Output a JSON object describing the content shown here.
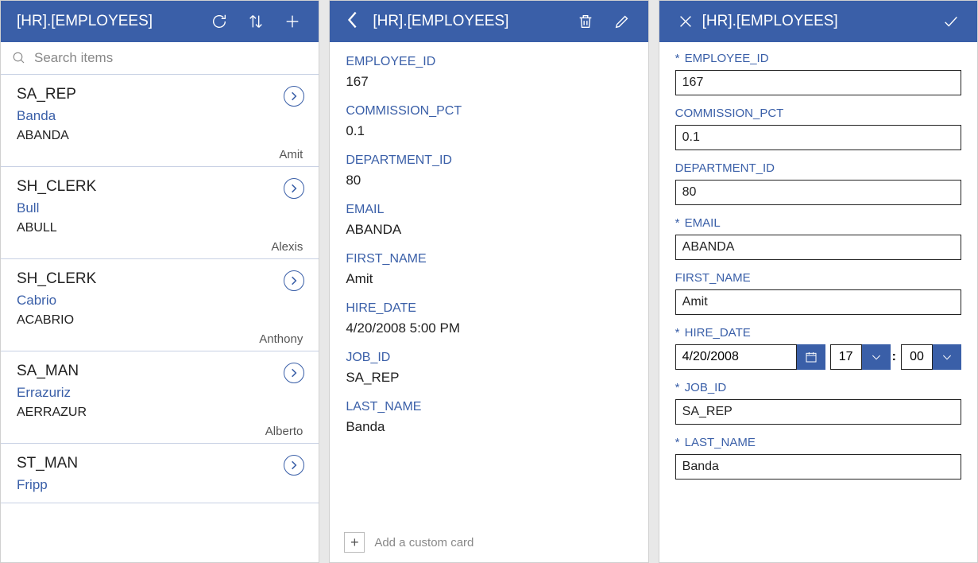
{
  "table_name": "[HR].[EMPLOYEES]",
  "search": {
    "placeholder": "Search items"
  },
  "list": [
    {
      "job": "SA_REP",
      "last": "Banda",
      "email": "ABANDA",
      "first": "Amit"
    },
    {
      "job": "SH_CLERK",
      "last": "Bull",
      "email": "ABULL",
      "first": "Alexis"
    },
    {
      "job": "SH_CLERK",
      "last": "Cabrio",
      "email": "ACABRIO",
      "first": "Anthony"
    },
    {
      "job": "SA_MAN",
      "last": "Errazuriz",
      "email": "AERRAZUR",
      "first": "Alberto"
    },
    {
      "job": "ST_MAN",
      "last": "Fripp",
      "email": "",
      "first": ""
    }
  ],
  "detail": {
    "fields": [
      {
        "label": "EMPLOYEE_ID",
        "value": "167"
      },
      {
        "label": "COMMISSION_PCT",
        "value": "0.1"
      },
      {
        "label": "DEPARTMENT_ID",
        "value": "80"
      },
      {
        "label": "EMAIL",
        "value": "ABANDA"
      },
      {
        "label": "FIRST_NAME",
        "value": "Amit"
      },
      {
        "label": "HIRE_DATE",
        "value": "4/20/2008 5:00 PM"
      },
      {
        "label": "JOB_ID",
        "value": "SA_REP"
      },
      {
        "label": "LAST_NAME",
        "value": "Banda"
      }
    ],
    "add_card_label": "Add a custom card"
  },
  "edit": {
    "labels": {
      "employee_id": "EMPLOYEE_ID",
      "commission_pct": "COMMISSION_PCT",
      "department_id": "DEPARTMENT_ID",
      "email": "EMAIL",
      "first_name": "FIRST_NAME",
      "hire_date": "HIRE_DATE",
      "job_id": "JOB_ID",
      "last_name": "LAST_NAME"
    },
    "values": {
      "employee_id": "167",
      "commission_pct": "0.1",
      "department_id": "80",
      "email": "ABANDA",
      "first_name": "Amit",
      "hire_date_date": "4/20/2008",
      "hire_date_hour": "17",
      "hire_date_min": "00",
      "job_id": "SA_REP",
      "last_name": "Banda"
    },
    "required": {
      "employee_id": true,
      "commission_pct": false,
      "department_id": false,
      "email": true,
      "first_name": false,
      "hire_date": true,
      "job_id": true,
      "last_name": true
    },
    "asterisk": "*"
  }
}
